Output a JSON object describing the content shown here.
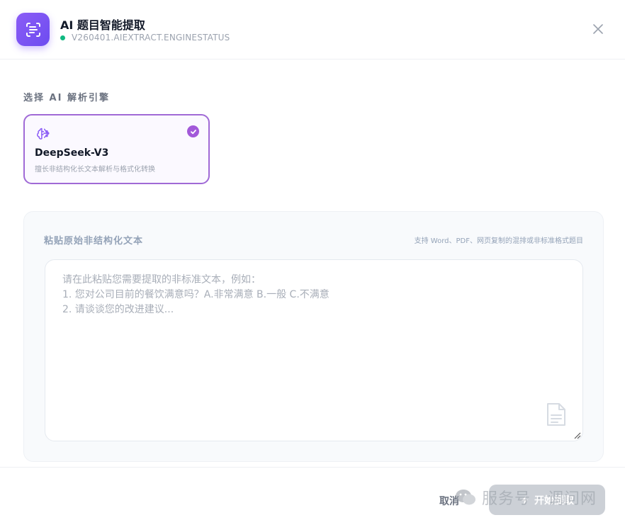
{
  "header": {
    "title": "AI 题目智能提取",
    "status_text": "V260401.AIEXTRACT.ENGINESTATUS",
    "status_color": "#10b981",
    "icon": "scan-text-icon",
    "close_icon": "close-icon"
  },
  "engine_section": {
    "label": "选择 AI 解析引擎",
    "engines": [
      {
        "name": "DeepSeek-V3",
        "description": "擅长非结构化长文本解析与格式化转换",
        "icon": "brain-icon",
        "selected": true
      }
    ]
  },
  "paste_section": {
    "label": "粘贴原始非结构化文本",
    "hint": "支持 Word、PDF、网页复制的混排或非标准格式题目",
    "value": "",
    "placeholder": "请在此粘贴您需要提取的非标准文本，例如：\n1. 您对公司目前的餐饮满意吗？A.非常满意 B.一般 C.不满意\n2. 请谈谈您的改进建议..."
  },
  "footer": {
    "cancel_label": "取消",
    "start_label": "开始提取",
    "start_icon": "bolt-icon"
  },
  "watermark": {
    "text": "服务号 · 调问网"
  },
  "colors": {
    "accent": "#7c4dff",
    "selected_border": "#a06ad6",
    "disabled_button": "#c4c8cf"
  }
}
